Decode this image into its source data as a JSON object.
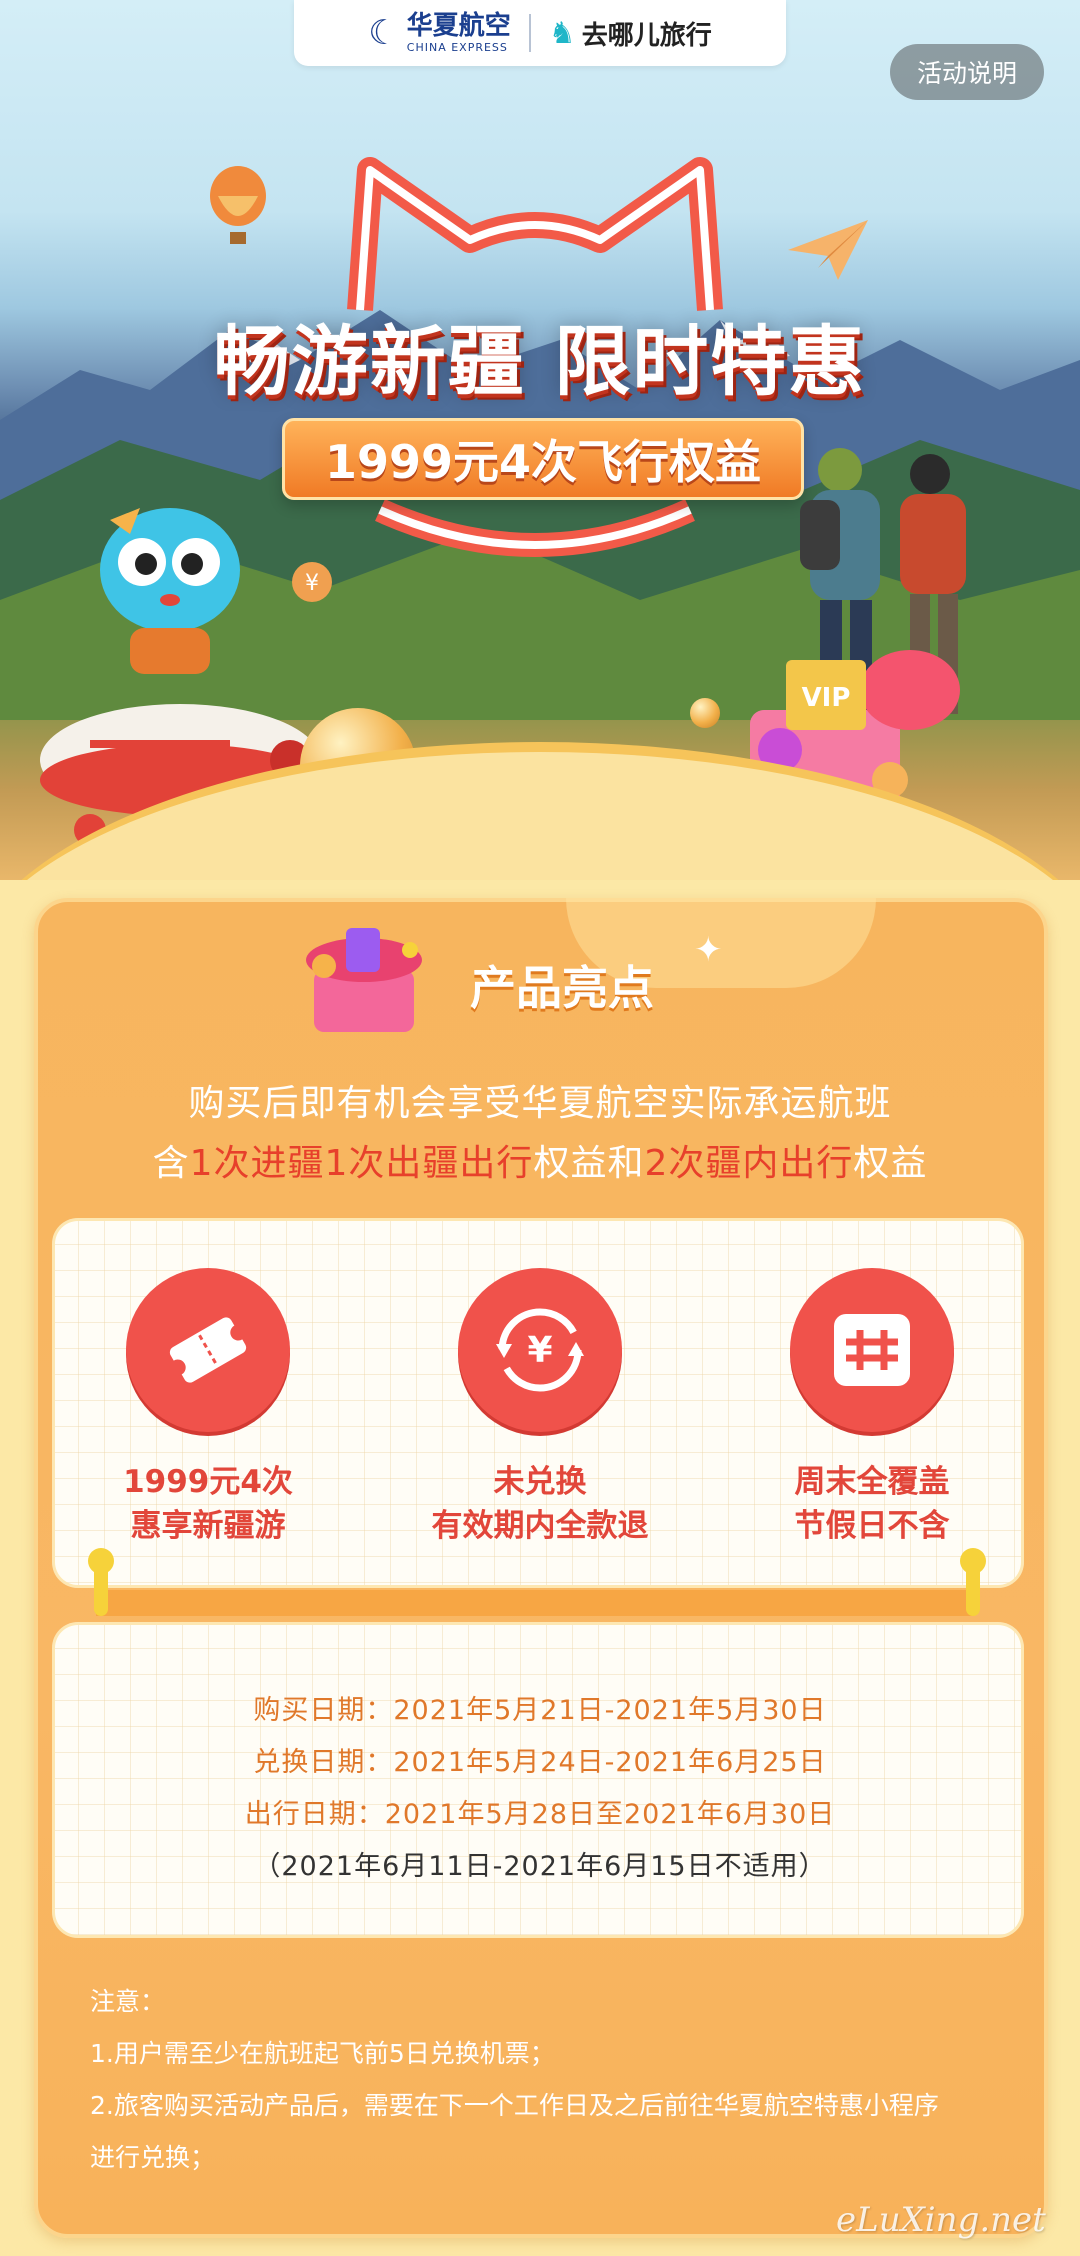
{
  "header": {
    "brand_a_cn": "华夏航空",
    "brand_a_en": "CHINA EXPRESS",
    "brand_b_cn": "去哪儿旅行",
    "rules_button": "活动说明"
  },
  "hero": {
    "title": "畅游新疆 限时特惠",
    "pill": "1999元4次飞行权益",
    "vip_label": "VIP"
  },
  "highlights": {
    "title": "产品亮点",
    "intro_line1": "购买后即有机会享受华夏航空实际承运航班",
    "intro_line2": {
      "p1": "含",
      "h1": "1次进疆1次出疆出行",
      "p2": "权益和",
      "h2": "2次疆内出行",
      "p3": "权益"
    }
  },
  "benefits": [
    {
      "icon": "ticket-icon",
      "line1": "1999元4次",
      "line2": "惠享新疆游"
    },
    {
      "icon": "yuan-refund-icon",
      "line1": "未兑换",
      "line2": "有效期内全款退"
    },
    {
      "icon": "calendar-icon",
      "line1": "周末全覆盖",
      "line2": "节假日不含"
    }
  ],
  "dates": {
    "purchase": "购买日期：2021年5月21日-2021年5月30日",
    "exchange": "兑换日期：2021年5月24日-2021年6月25日",
    "travel": "出行日期：2021年5月28日至2021年6月30日",
    "exclusion": "（2021年6月11日-2021年6月15日不适用）"
  },
  "notes": {
    "title": "注意：",
    "items": [
      "1.用户需至少在航班起飞前5日兑换机票；",
      "2.旅客购买活动产品后，需要在下一个工作日及之后前往华夏航空特惠小程序",
      "进行兑换；"
    ]
  },
  "watermark": "eLuXing.net",
  "colors": {
    "accent_red": "#E7402B",
    "card_orange": "#F7B55E",
    "page_bg": "#FCE8A6"
  }
}
